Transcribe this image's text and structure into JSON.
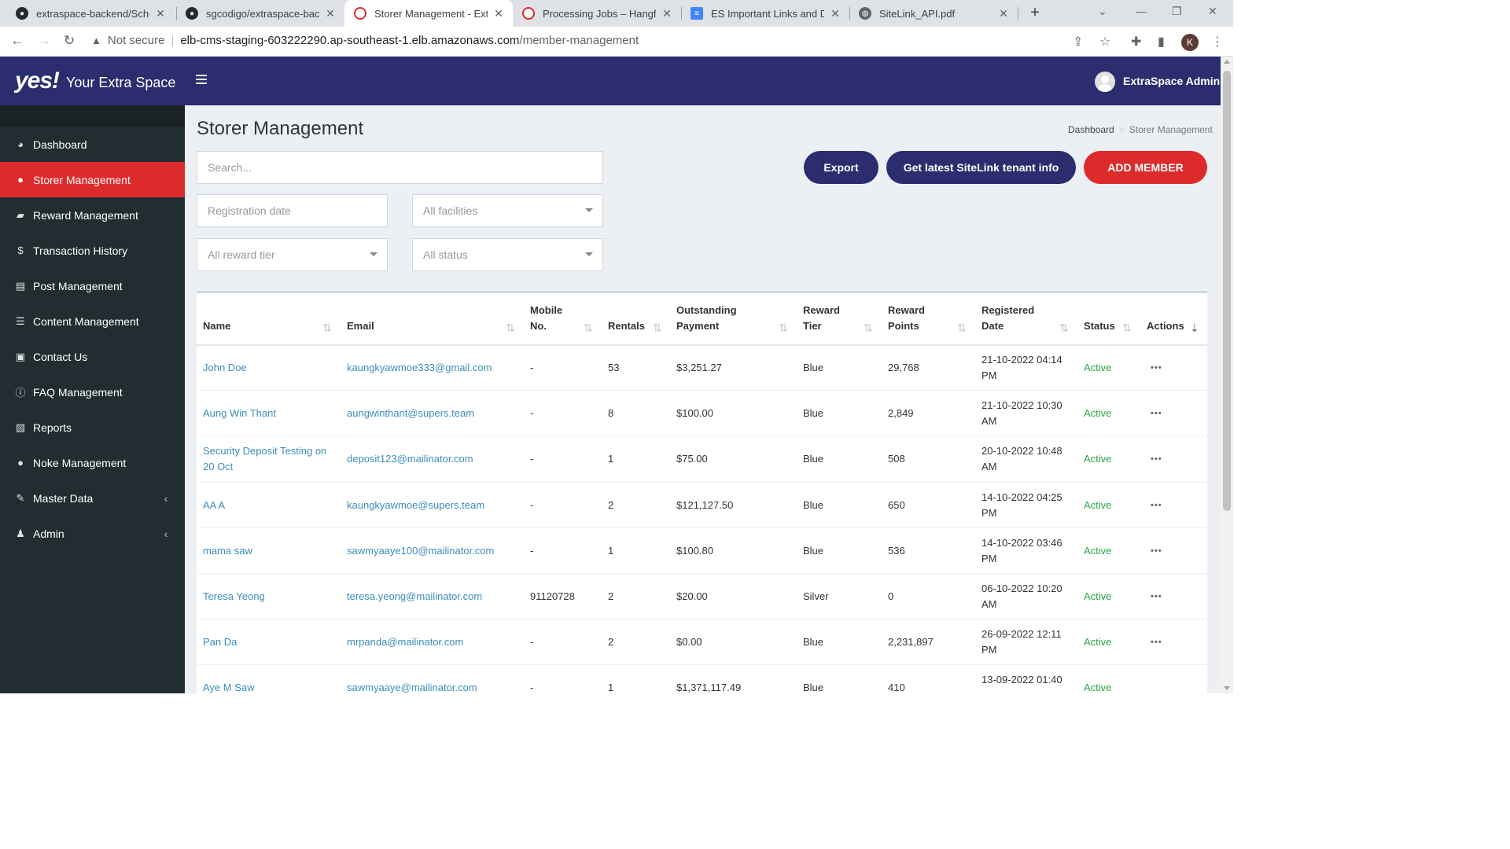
{
  "browser": {
    "tabs": [
      {
        "title": "extraspace-backend/Schedul",
        "icon": "github-icon"
      },
      {
        "title": "sgcodigo/extraspace-backe",
        "icon": "github-icon"
      },
      {
        "title": "Storer Management - Extra",
        "icon": "extraspace-favicon-icon"
      },
      {
        "title": "Processing Jobs – Hangfire",
        "icon": "hangfire-favicon-icon"
      },
      {
        "title": "ES Important Links and Doc",
        "icon": "google-docs-icon"
      },
      {
        "title": "SiteLink_API.pdf",
        "icon": "globe-icon"
      }
    ],
    "url_security": "Not secure",
    "url_host": "elb-cms-staging-603222290.ap-southeast-1.elb.amazonaws.com",
    "url_path": "/member-management",
    "profile_initial": "K"
  },
  "header": {
    "logo_mark": "yes!",
    "logo_text": "Your Extra Space",
    "user_name": "ExtraSpace Admin"
  },
  "sidebar": {
    "items": [
      {
        "label": "Dashboard",
        "icon": "dashboard-icon"
      },
      {
        "label": "Storer Management",
        "icon": "user-icon"
      },
      {
        "label": "Reward Management",
        "icon": "book-icon"
      },
      {
        "label": "Transaction History",
        "icon": "dollar-icon"
      },
      {
        "label": "Post Management",
        "icon": "newspaper-icon"
      },
      {
        "label": "Content Management",
        "icon": "list-icon"
      },
      {
        "label": "Contact Us",
        "icon": "address-book-icon"
      },
      {
        "label": "FAQ Management",
        "icon": "info-icon"
      },
      {
        "label": "Reports",
        "icon": "file-excel-icon"
      },
      {
        "label": "Noke Management",
        "icon": "user-icon"
      },
      {
        "label": "Master Data",
        "icon": "wrench-icon"
      },
      {
        "label": "Admin",
        "icon": "user-tie-icon"
      }
    ]
  },
  "page": {
    "title": "Storer Management",
    "breadcrumb": [
      "Dashboard",
      "Storer Management"
    ]
  },
  "filters": {
    "search_placeholder": "Search...",
    "registration_date_placeholder": "Registration date",
    "facility_selected": "All facilities",
    "reward_tier_selected": "All reward tier",
    "status_selected": "All status"
  },
  "actions": {
    "export_label": "Export",
    "sitelink_label": "Get latest SiteLink tenant info",
    "add_member_label": "ADD MEMBER"
  },
  "table": {
    "columns": [
      {
        "line1": "",
        "line2": "Name"
      },
      {
        "line1": "",
        "line2": "Email"
      },
      {
        "line1": "Mobile",
        "line2": "No."
      },
      {
        "line1": "",
        "line2": "Rentals"
      },
      {
        "line1": "Outstanding",
        "line2": "Payment"
      },
      {
        "line1": "Reward",
        "line2": "Tier"
      },
      {
        "line1": "Reward",
        "line2": "Points"
      },
      {
        "line1": "Registered",
        "line2": "Date"
      },
      {
        "line1": "",
        "line2": "Status"
      },
      {
        "line1": "",
        "line2": "Actions"
      }
    ],
    "rows": [
      {
        "name": [
          "John Doe",
          ""
        ],
        "email": "kaungkyawmoe333@gmail.com",
        "mobile": "-",
        "rentals": "53",
        "payment": "$3,251.27",
        "tier": "Blue",
        "points": "29,768",
        "date": [
          "21-10-2022 04:14",
          "PM"
        ],
        "status": "Active",
        "actions": "•••"
      },
      {
        "name": [
          "Aung Win Thant",
          ""
        ],
        "email": "aungwinthant@supers.team",
        "mobile": "-",
        "rentals": "8",
        "payment": "$100.00",
        "tier": "Blue",
        "points": "2,849",
        "date": [
          "21-10-2022 10:30",
          "AM"
        ],
        "status": "Active",
        "actions": "•••"
      },
      {
        "name": [
          "Security Deposit Testing on",
          "20 Oct"
        ],
        "email": "deposit123@mailinator.com",
        "mobile": "-",
        "rentals": "1",
        "payment": "$75.00",
        "tier": "Blue",
        "points": "508",
        "date": [
          "20-10-2022 10:48",
          "AM"
        ],
        "status": "Active",
        "actions": "•••"
      },
      {
        "name": [
          "AA A",
          ""
        ],
        "email": "kaungkyawmoe@supers.team",
        "mobile": "-",
        "rentals": "2",
        "payment": "$121,127.50",
        "tier": "Blue",
        "points": "650",
        "date": [
          "14-10-2022 04:25",
          "PM"
        ],
        "status": "Active",
        "actions": "•••"
      },
      {
        "name": [
          "mama saw",
          ""
        ],
        "email": "sawmyaaye100@mailinator.com",
        "mobile": "-",
        "rentals": "1",
        "payment": "$100.80",
        "tier": "Blue",
        "points": "536",
        "date": [
          "14-10-2022 03:46",
          "PM"
        ],
        "status": "Active",
        "actions": "•••"
      },
      {
        "name": [
          "Teresa Yeong",
          ""
        ],
        "email": "teresa.yeong@mailinator.com",
        "mobile": "91120728",
        "rentals": "2",
        "payment": "$20.00",
        "tier": "Silver",
        "points": "0",
        "date": [
          "06-10-2022 10:20",
          "AM"
        ],
        "status": "Active",
        "actions": "•••"
      },
      {
        "name": [
          "Pan Da",
          ""
        ],
        "email": "mrpanda@mailinator.com",
        "mobile": "-",
        "rentals": "2",
        "payment": "$0.00",
        "tier": "Blue",
        "points": "2,231,897",
        "date": [
          "26-09-2022 12:11",
          "PM"
        ],
        "status": "Active",
        "actions": "•••"
      },
      {
        "name": [
          "Aye M Saw",
          ""
        ],
        "email": "sawmyaaye@mailinator.com",
        "mobile": "-",
        "rentals": "1",
        "payment": "$1,371,117.49",
        "tier": "Blue",
        "points": "410",
        "date": [
          "13-09-2022 01:40",
          ""
        ],
        "status": "Active",
        "actions": "•••"
      }
    ]
  },
  "colors": {
    "header_navy": "#2c2d6e",
    "sidebar_dark": "#222d32",
    "active_red": "#dd2b2b",
    "link_blue": "#3c8dbc",
    "status_green": "#2aa944"
  }
}
